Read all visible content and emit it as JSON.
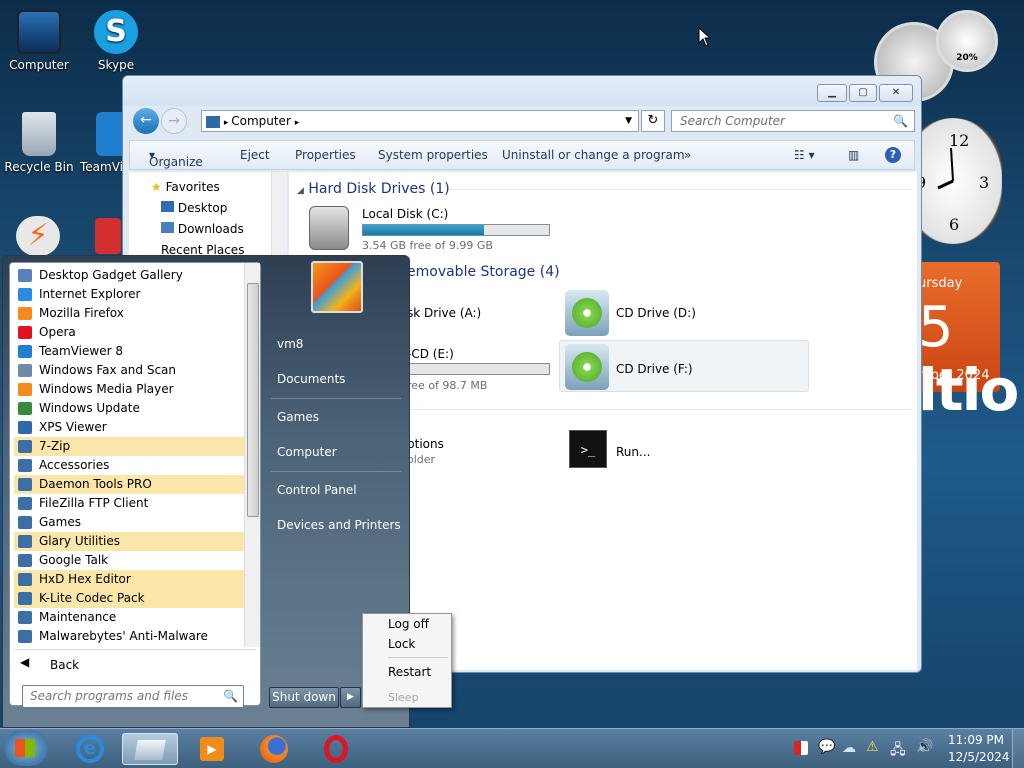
{
  "desktop": {
    "icons": [
      {
        "label": "Computer"
      },
      {
        "label": "Skype"
      },
      {
        "label": "Recycle Bin"
      },
      {
        "label": "TeamVie"
      }
    ],
    "gadgets": {
      "calendar_day": "5",
      "calendar_weekday": "ursday",
      "calendar_month_year": "mber 2024",
      "cpu_percent": "20%",
      "wallpaper_text": "ltio"
    }
  },
  "explorer": {
    "address": "Computer",
    "search_placeholder": "Search Computer",
    "toolbar": [
      "Organize",
      "Eject",
      "Properties",
      "System properties",
      "Uninstall or change a program",
      "»"
    ],
    "nav": [
      "Favorites",
      "Desktop",
      "Downloads",
      "Recent Places"
    ],
    "groups": {
      "hdd": "Hard Disk Drives (1)",
      "removable": "emovable Storage (4)"
    },
    "drives": {
      "c_label": "Local Disk (C:)",
      "c_free": "3.54 GB free of 9.99 GB",
      "c_used_fraction": 0.65,
      "a_label": "sk Drive (A:)",
      "d_label": "CD Drive (D:)",
      "e_label": "-CD (E:)",
      "e_free": "ree of 98.7 MB",
      "f_label": "CD Drive (F:)"
    },
    "other": {
      "options_label": "ptions",
      "folder_label": "older",
      "run_label": "Run..."
    }
  },
  "startmenu": {
    "programs": [
      {
        "label": "Desktop Gadget Gallery",
        "highlight": false
      },
      {
        "label": "Internet Explorer",
        "highlight": false
      },
      {
        "label": "Mozilla Firefox",
        "highlight": false
      },
      {
        "label": "Opera",
        "highlight": false
      },
      {
        "label": "TeamViewer 8",
        "highlight": false
      },
      {
        "label": "Windows Fax and Scan",
        "highlight": false
      },
      {
        "label": "Windows Media Player",
        "highlight": false
      },
      {
        "label": "Windows Update",
        "highlight": false
      },
      {
        "label": "XPS Viewer",
        "highlight": false
      },
      {
        "label": "7-Zip",
        "highlight": true
      },
      {
        "label": "Accessories",
        "highlight": false
      },
      {
        "label": "Daemon Tools PRO",
        "highlight": true
      },
      {
        "label": "FileZilla FTP Client",
        "highlight": false
      },
      {
        "label": "Games",
        "highlight": false
      },
      {
        "label": "Glary Utilities",
        "highlight": true
      },
      {
        "label": "Google Talk",
        "highlight": false
      },
      {
        "label": "HxD Hex Editor",
        "highlight": true
      },
      {
        "label": "K-Lite Codec Pack",
        "highlight": true
      },
      {
        "label": "Maintenance",
        "highlight": false
      },
      {
        "label": "Malwarebytes' Anti-Malware",
        "highlight": false
      }
    ],
    "back_label": "Back",
    "search_placeholder": "Search programs and files",
    "right_items": [
      "vm8",
      "Documents",
      "Games",
      "Computer",
      "Control Panel",
      "Devices and Printers"
    ],
    "shutdown_label": "Shut down"
  },
  "context_menu": {
    "items": [
      "Log off",
      "Lock",
      "Restart",
      "Sleep"
    ]
  },
  "taskbar": {
    "time": "11:09 PM",
    "date": "12/5/2024"
  }
}
